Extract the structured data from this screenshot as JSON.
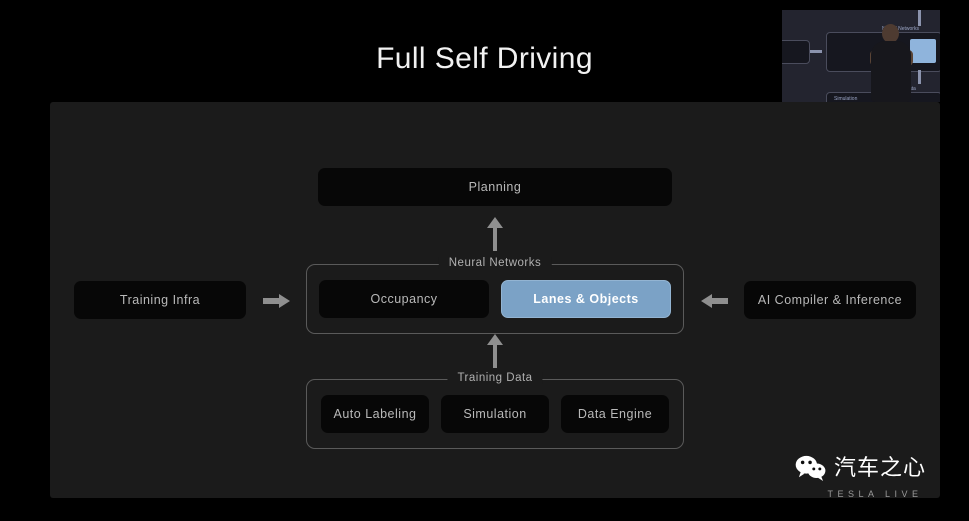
{
  "slide": {
    "title": "Full Self Driving"
  },
  "diagram": {
    "planning": {
      "label": "Planning"
    },
    "neural_networks": {
      "group_label": "Neural Networks",
      "nodes": [
        {
          "label": "Occupancy",
          "highlighted": false
        },
        {
          "label": "Lanes & Objects",
          "highlighted": true
        }
      ]
    },
    "training_data": {
      "group_label": "Training Data",
      "nodes": [
        {
          "label": "Auto Labeling"
        },
        {
          "label": "Simulation"
        },
        {
          "label": "Data Engine"
        }
      ]
    },
    "left_box": {
      "label": "Training Infra"
    },
    "right_box": {
      "label": "AI Compiler & Inference"
    },
    "arrows": [
      {
        "name": "training-data-to-neural-networks",
        "direction": "up"
      },
      {
        "name": "neural-networks-to-planning",
        "direction": "up"
      },
      {
        "name": "training-infra-to-neural-networks",
        "direction": "right"
      },
      {
        "name": "ai-compiler-to-neural-networks",
        "direction": "left"
      }
    ],
    "colors": {
      "panel_background": "#1b1b1b",
      "node_background": "#070707",
      "highlight": "#7ba2c6",
      "label_text": "#b9b9b9",
      "group_border": "#5a5a5a"
    }
  },
  "presenter_inset": {
    "labels": {
      "neural_networks": "Neural Networks",
      "training_data": "Training Data",
      "simulation": "Simulation"
    }
  },
  "watermark": {
    "icon": "wechat-icon",
    "name": "汽车之心",
    "tagline": "TESLA LIVE"
  }
}
